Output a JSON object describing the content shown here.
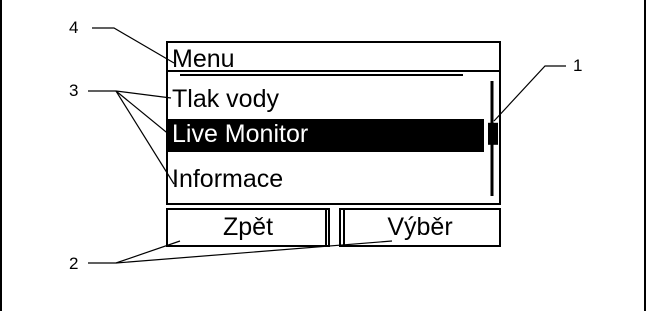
{
  "callouts": [
    "4",
    "3",
    "1",
    "2"
  ],
  "display": {
    "title": "Menu",
    "menu_items": [
      {
        "label": "Tlak vody",
        "selected": false
      },
      {
        "label": "Live Monitor",
        "selected": true
      },
      {
        "label": "Informace",
        "selected": false
      }
    ],
    "softkeys": {
      "left": "Zpět",
      "right": "Výběr"
    },
    "scroll_position": 0.45
  },
  "colors": {
    "line": "#000000",
    "selection_bg": "#000000",
    "selection_text": "#ffffff",
    "background": "#ffffff"
  }
}
